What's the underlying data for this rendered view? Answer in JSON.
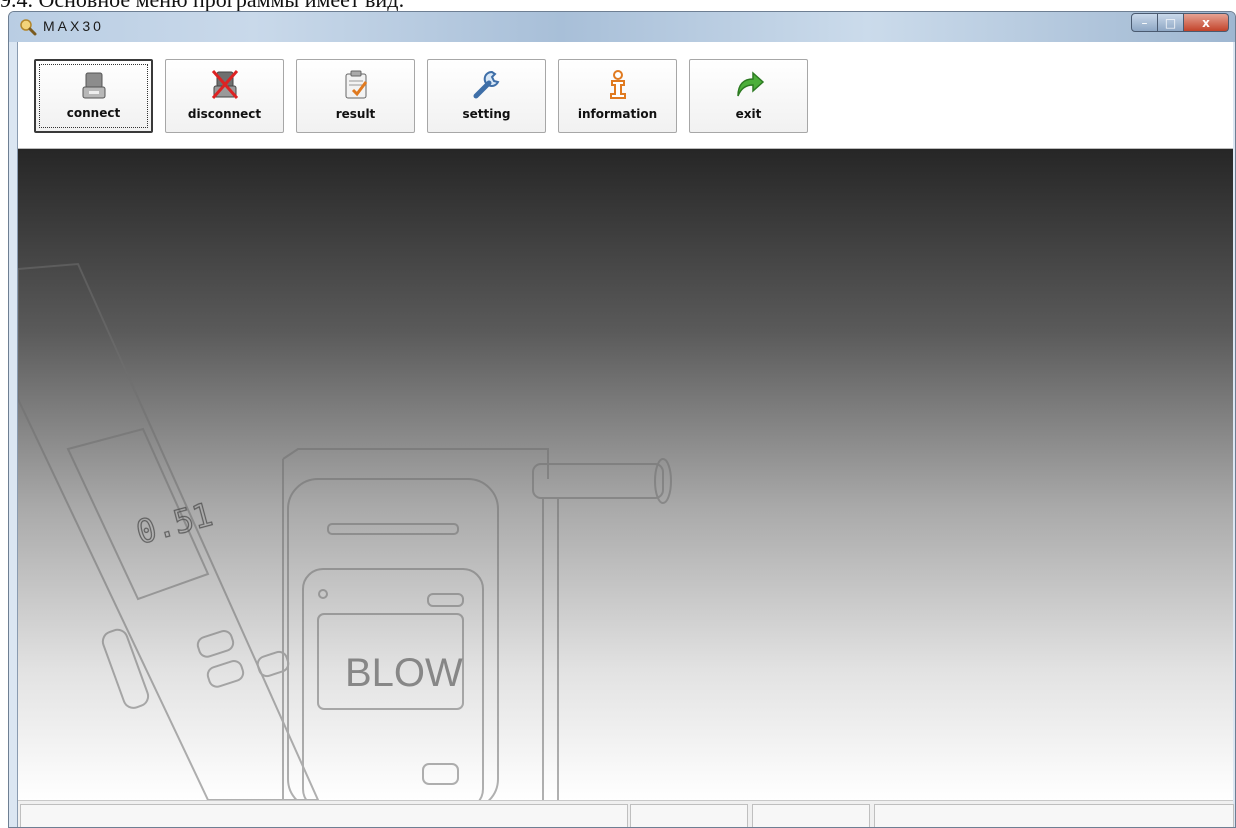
{
  "document": {
    "caption": "9.4. Основное меню программы имеет вид:"
  },
  "window": {
    "title": "MAX30",
    "controls": {
      "minimize": "–",
      "maximize": "□",
      "close": "x"
    }
  },
  "toolbar": {
    "buttons": [
      {
        "label": "connect",
        "icon": "usb-plug-icon",
        "active": true
      },
      {
        "label": "disconnect",
        "icon": "usb-disconnect-icon",
        "active": false
      },
      {
        "label": "result",
        "icon": "clipboard-result-icon",
        "active": false
      },
      {
        "label": "setting",
        "icon": "wrench-icon",
        "active": false
      },
      {
        "label": "information",
        "icon": "info-person-icon",
        "active": false
      },
      {
        "label": "exit",
        "icon": "green-arrow-icon",
        "active": false
      }
    ]
  },
  "background": {
    "device_display_reading": "0.51",
    "device_screen_text": "BLOW"
  },
  "colors": {
    "accent_orange": "#e07a20",
    "exit_green": "#4caf3a",
    "window_blue": "#b9cde3"
  }
}
